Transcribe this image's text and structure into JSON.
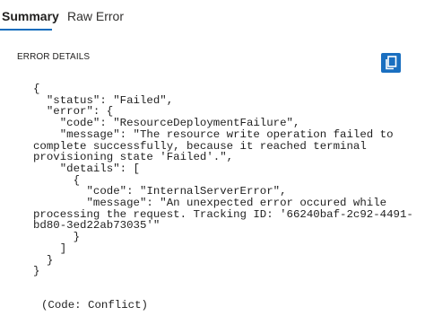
{
  "tabs": [
    {
      "label": "Summary",
      "active": true
    },
    {
      "label": "Raw Error",
      "active": false
    }
  ],
  "section_title": "ERROR DETAILS",
  "copy_button": {
    "icon": "copy-icon",
    "color": "#1a6fc0"
  },
  "error_json": "{\n  \"status\": \"Failed\",\n  \"error\": {\n    \"code\": \"ResourceDeploymentFailure\",\n    \"message\": \"The resource write operation failed to\ncomplete successfully, because it reached terminal\nprovisioning state 'Failed'.\",\n    \"details\": [\n      {\n        \"code\": \"InternalServerError\",\n        \"message\": \"An unexpected error occured while\nprocessing the request. Tracking ID: '66240baf-2c92-4491-\nbd80-3ed22ab73035'\"\n      }\n    ]\n  }\n}",
  "footer_code": "(Code: Conflict)",
  "colors": {
    "accent": "#0f6cbd",
    "text": "#1f1f1f"
  }
}
